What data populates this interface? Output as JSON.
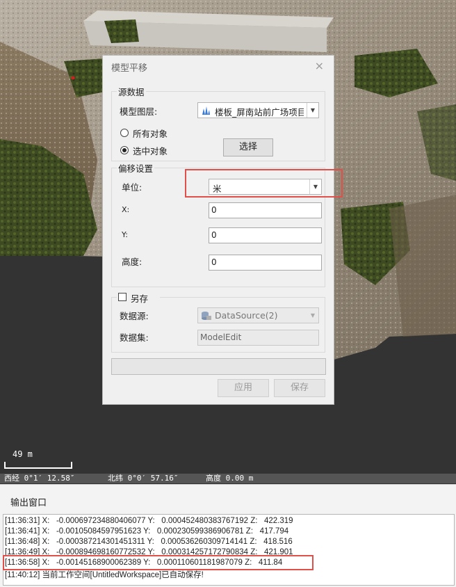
{
  "scene": {
    "scale_label": "49 m",
    "status": {
      "longitude": "西经 0°1′ 12.58″",
      "latitude": "北纬 0°0′ 57.16″",
      "altitude": "高度 0.00 m"
    }
  },
  "dialog": {
    "title": "模型平移",
    "close_icon": "×",
    "source_group": {
      "label": "源数据",
      "layer_label": "模型图层:",
      "layer_value": "楼板_屏南站前广场项目",
      "radio_all": "所有对象",
      "radio_selected": "选中对象",
      "selected_option": "选中对象",
      "select_button": "选择"
    },
    "offset_group": {
      "label": "偏移设置",
      "unit_label": "单位:",
      "unit_value": "米",
      "x_label": "X:",
      "x_value": "0",
      "y_label": "Y:",
      "y_value": "0",
      "height_label": "高度:",
      "height_value": "0"
    },
    "save_as_group": {
      "label": "另存",
      "checked": false,
      "datasource_label": "数据源:",
      "datasource_value": "DataSource(2)",
      "dataset_label": "数据集:",
      "dataset_value": "ModelEdit"
    },
    "apply_button": "应用",
    "save_button": "保存"
  },
  "output": {
    "title": "输出窗口",
    "lines": [
      "[11:36:31] X:   -0.000697234880406077 Y:   0.000452480383767192 Z:   422.319",
      "[11:36:41] X:   -0.00105084597951623 Y:   0.000230599386906781 Z:   417.794",
      "[11:36:48] X:   -0.000387214301451311 Y:   0.000536260309714141 Z:   418.516",
      "[11:36:49] X:   -0.000894698160772532 Y:   0.000314257172790834 Z:   421.901",
      "[11:36:58] X:   -0.00145168900062389 Y:   0.000110601181987079 Z:   411.84",
      "[11:40:12] 当前工作空间[UntitledWorkspace]已自动保存!"
    ]
  },
  "colors": {
    "highlight": "#e0504a",
    "scene_ground": "#333333"
  }
}
